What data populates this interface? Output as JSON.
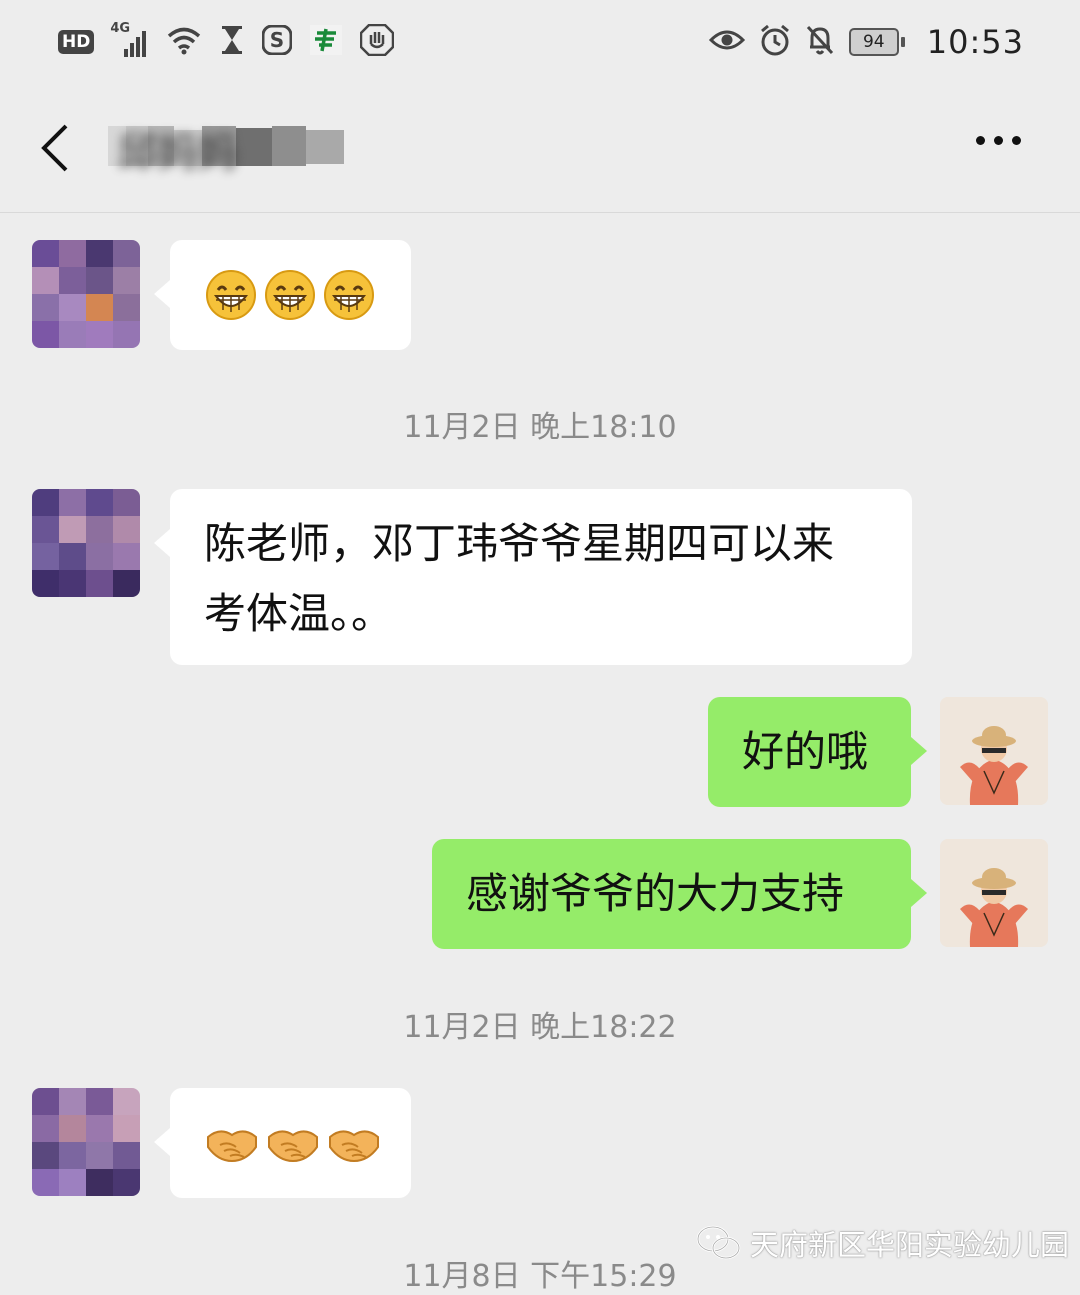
{
  "status_bar": {
    "hd_badge": "HD",
    "network": "4G",
    "battery": "94",
    "time": "10:53",
    "icons_left": [
      "hd-icon",
      "signal-icon",
      "wifi-icon",
      "hourglass-icon",
      "s-app-icon",
      "bank-app-icon",
      "hand-icon"
    ],
    "icons_right": [
      "eye-icon",
      "alarm-icon",
      "bell-muted-icon",
      "battery-icon"
    ]
  },
  "header": {
    "title": "邱妈妈",
    "back_icon": "chevron-left-icon",
    "more_icon": "more-dots-icon"
  },
  "messages": [
    {
      "side": "left",
      "type": "emoji",
      "emoji": [
        "😁",
        "😁",
        "😁"
      ]
    },
    {
      "type": "timestamp",
      "text": "11月2日 晚上18:10"
    },
    {
      "side": "left",
      "type": "text",
      "lines": [
        "陈老师，邓丁玮爷爷星期四可以来",
        "考体温。。"
      ]
    },
    {
      "side": "right",
      "type": "text",
      "text": "好的哦"
    },
    {
      "side": "right",
      "type": "text",
      "text": "感谢爷爷的大力支持"
    },
    {
      "type": "timestamp",
      "text": "11月2日 晚上18:22"
    },
    {
      "side": "left",
      "type": "emoji",
      "emoji": [
        "🤝",
        "🤝",
        "🤝"
      ]
    },
    {
      "type": "timestamp",
      "text": "11月8日 下午15:29"
    }
  ],
  "watermark": {
    "text": "天府新区华阳实验幼儿园",
    "icon": "wechat-icon"
  },
  "colors": {
    "background": "#ededed",
    "bubble_left": "#ffffff",
    "bubble_right": "#95ec69",
    "timestamp": "#8a8a8a"
  }
}
